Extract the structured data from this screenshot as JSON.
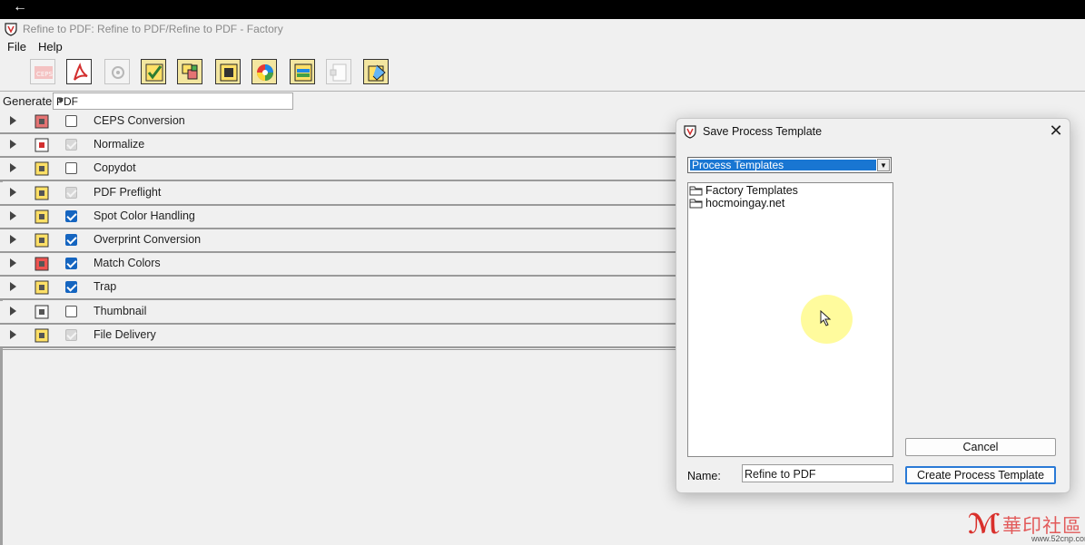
{
  "window": {
    "title": "Refine to PDF: Refine to PDF/Refine to PDF - Factory",
    "back_glyph": "←"
  },
  "menu": [
    "File",
    "Help"
  ],
  "toolbar": {
    "icons": [
      {
        "name": "ceps-conversion-icon",
        "enabled": false
      },
      {
        "name": "normalize-icon",
        "enabled": true
      },
      {
        "name": "copydot-icon",
        "enabled": false
      },
      {
        "name": "pdf-preflight-icon",
        "enabled": true
      },
      {
        "name": "spot-color-handling-icon",
        "enabled": true
      },
      {
        "name": "overprint-conversion-icon",
        "enabled": true
      },
      {
        "name": "match-colors-icon",
        "enabled": true
      },
      {
        "name": "trap-icon",
        "enabled": true
      },
      {
        "name": "thumbnail-icon",
        "enabled": false
      },
      {
        "name": "file-delivery-icon",
        "enabled": true
      }
    ]
  },
  "generate": {
    "label": "Generate",
    "value": "PDF"
  },
  "steps": [
    {
      "label": "CEPS Conversion",
      "state": "unchecked",
      "icon": "ceps-icon"
    },
    {
      "label": "Normalize",
      "state": "locked",
      "icon": "pdf-icon"
    },
    {
      "label": "Copydot",
      "state": "unchecked",
      "icon": "copydot-icon"
    },
    {
      "label": "PDF Preflight",
      "state": "locked",
      "icon": "preflight-icon"
    },
    {
      "label": "Spot Color Handling",
      "state": "checked",
      "icon": "spot-color-icon"
    },
    {
      "label": "Overprint Conversion",
      "state": "checked",
      "icon": "overprint-icon"
    },
    {
      "label": "Match Colors",
      "state": "checked",
      "icon": "match-colors-icon"
    },
    {
      "label": "Trap",
      "state": "checked",
      "icon": "trap-icon"
    },
    {
      "label": "Thumbnail",
      "state": "unchecked",
      "icon": "thumbnail-icon"
    },
    {
      "label": "File Delivery",
      "state": "locked",
      "icon": "file-delivery-icon"
    }
  ],
  "dialog": {
    "title": "Save Process Template",
    "close_glyph": "✕",
    "location": "Process Templates",
    "folders": [
      "Factory Templates",
      "hocmoingay.net"
    ],
    "cancel_label": "Cancel",
    "create_label": "Create Process Template",
    "name_label": "Name:",
    "name_value": "Refine to PDF"
  },
  "watermark": {
    "cn_text": "華印社區",
    "url": "www.52cnp.com"
  },
  "colors": {
    "accent": "#1976d2",
    "checkbox": "#1565c0",
    "cursor_halo": "#fffa8c"
  }
}
